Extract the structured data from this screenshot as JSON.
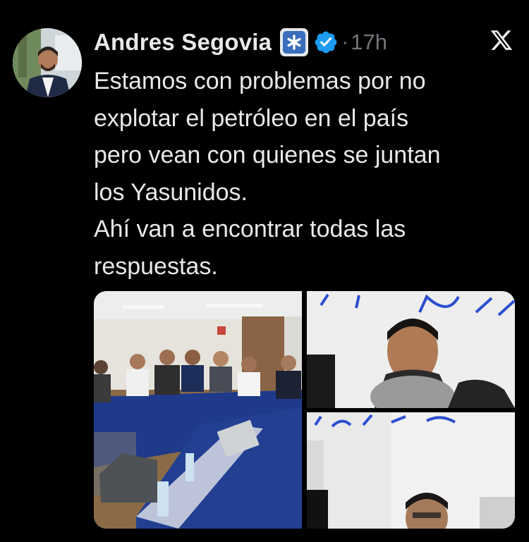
{
  "tweet": {
    "author_name": "Andres Segovia",
    "affiliation_badge_icon": "asterisk-badge-icon",
    "verified_icon": "verified-badge-icon",
    "separator": "·",
    "timestamp": "17h",
    "platform_icon": "x-logo-icon",
    "text_lines": [
      "Estamos con problemas por no",
      "explotar el petróleo en el país",
      "pero vean con quienes se juntan",
      "los Yasunidos.",
      "Ahí van a encontrar todas las",
      "respuestas."
    ]
  },
  "media": {
    "photo_count": 3
  },
  "colors": {
    "background": "#000000",
    "text_primary": "#e7e9ea",
    "text_secondary": "#71767b",
    "verified_blue": "#1d9bf0"
  }
}
